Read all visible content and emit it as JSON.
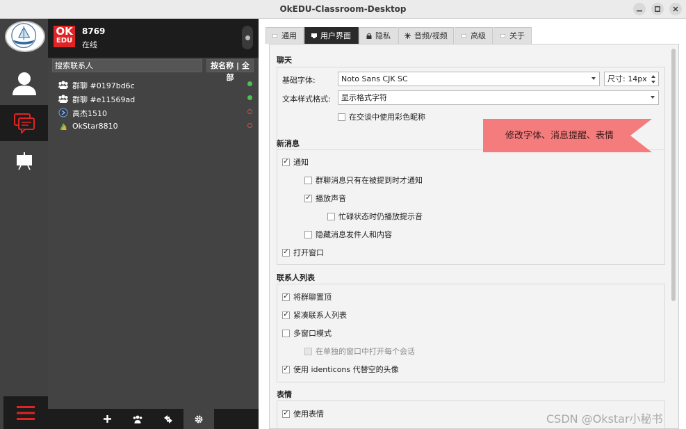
{
  "window": {
    "title": "OkEDU-Classroom-Desktop"
  },
  "profile": {
    "logo_line1": "OK",
    "logo_line2": "EDU",
    "name": "8769",
    "status": "在线"
  },
  "search": {
    "placeholder": "搜索联系人",
    "sort_label": "按名称 | 全部"
  },
  "contacts": [
    {
      "name": "群聊 #0197bd6c",
      "type": "group",
      "online": true
    },
    {
      "name": "群聊 #e11569ad",
      "type": "group",
      "online": true
    },
    {
      "name": "高杰1510",
      "type": "friend",
      "online": false
    },
    {
      "name": "OkStar8810",
      "type": "friend",
      "online": false
    }
  ],
  "tabs": [
    {
      "label": "通用",
      "active": false
    },
    {
      "label": "用户界面",
      "active": true
    },
    {
      "label": "隐私",
      "active": false
    },
    {
      "label": "音频/视频",
      "active": false
    },
    {
      "label": "高级",
      "active": false
    },
    {
      "label": "关于",
      "active": false
    }
  ],
  "chat_section": {
    "title": "聊天",
    "base_font_label": "基础字体:",
    "base_font_value": "Noto Sans CJK SC",
    "size_label": "尺寸:",
    "size_value": "14px",
    "text_style_label": "文本样式格式:",
    "text_style_value": "显示格式字符",
    "colored_nicknames": {
      "label": "在交谈中使用彩色昵称",
      "checked": false
    }
  },
  "new_message_section": {
    "title": "新消息",
    "notify": {
      "label": "通知",
      "checked": true
    },
    "group_mention_only": {
      "label": "群聊消息只有在被提到时才通知",
      "checked": false
    },
    "play_sound": {
      "label": "播放声音",
      "checked": true
    },
    "busy_sound": {
      "label": "忙碌状态时仍播放提示音",
      "checked": false
    },
    "hide_sender": {
      "label": "隐藏消息发件人和内容",
      "checked": false
    },
    "open_window": {
      "label": "打开窗口",
      "checked": true
    }
  },
  "contact_list_section": {
    "title": "联系人列表",
    "groups_on_top": {
      "label": "将群聊置顶",
      "checked": true
    },
    "compact_list": {
      "label": "紧凑联系人列表",
      "checked": true
    },
    "multi_window": {
      "label": "多窗口模式",
      "checked": false
    },
    "separate_window": {
      "label": "在单独的窗口中打开每个会话",
      "checked": false
    },
    "identicons": {
      "label": "使用 identicons 代替空的头像",
      "checked": true
    }
  },
  "emoji_section": {
    "title": "表情",
    "use_emoji": {
      "label": "使用表情",
      "checked": true
    }
  },
  "callout": {
    "text": "修改字体、消息提醒、表情"
  },
  "watermark": {
    "text": "CSDN @Okstar小秘书"
  },
  "colors": {
    "accent_red": "#e02424",
    "callout_fill": "#f47c7c",
    "online_green": "#4ec24e",
    "offline_red": "#d84a4a",
    "dark_bg": "#1c1c1c"
  }
}
